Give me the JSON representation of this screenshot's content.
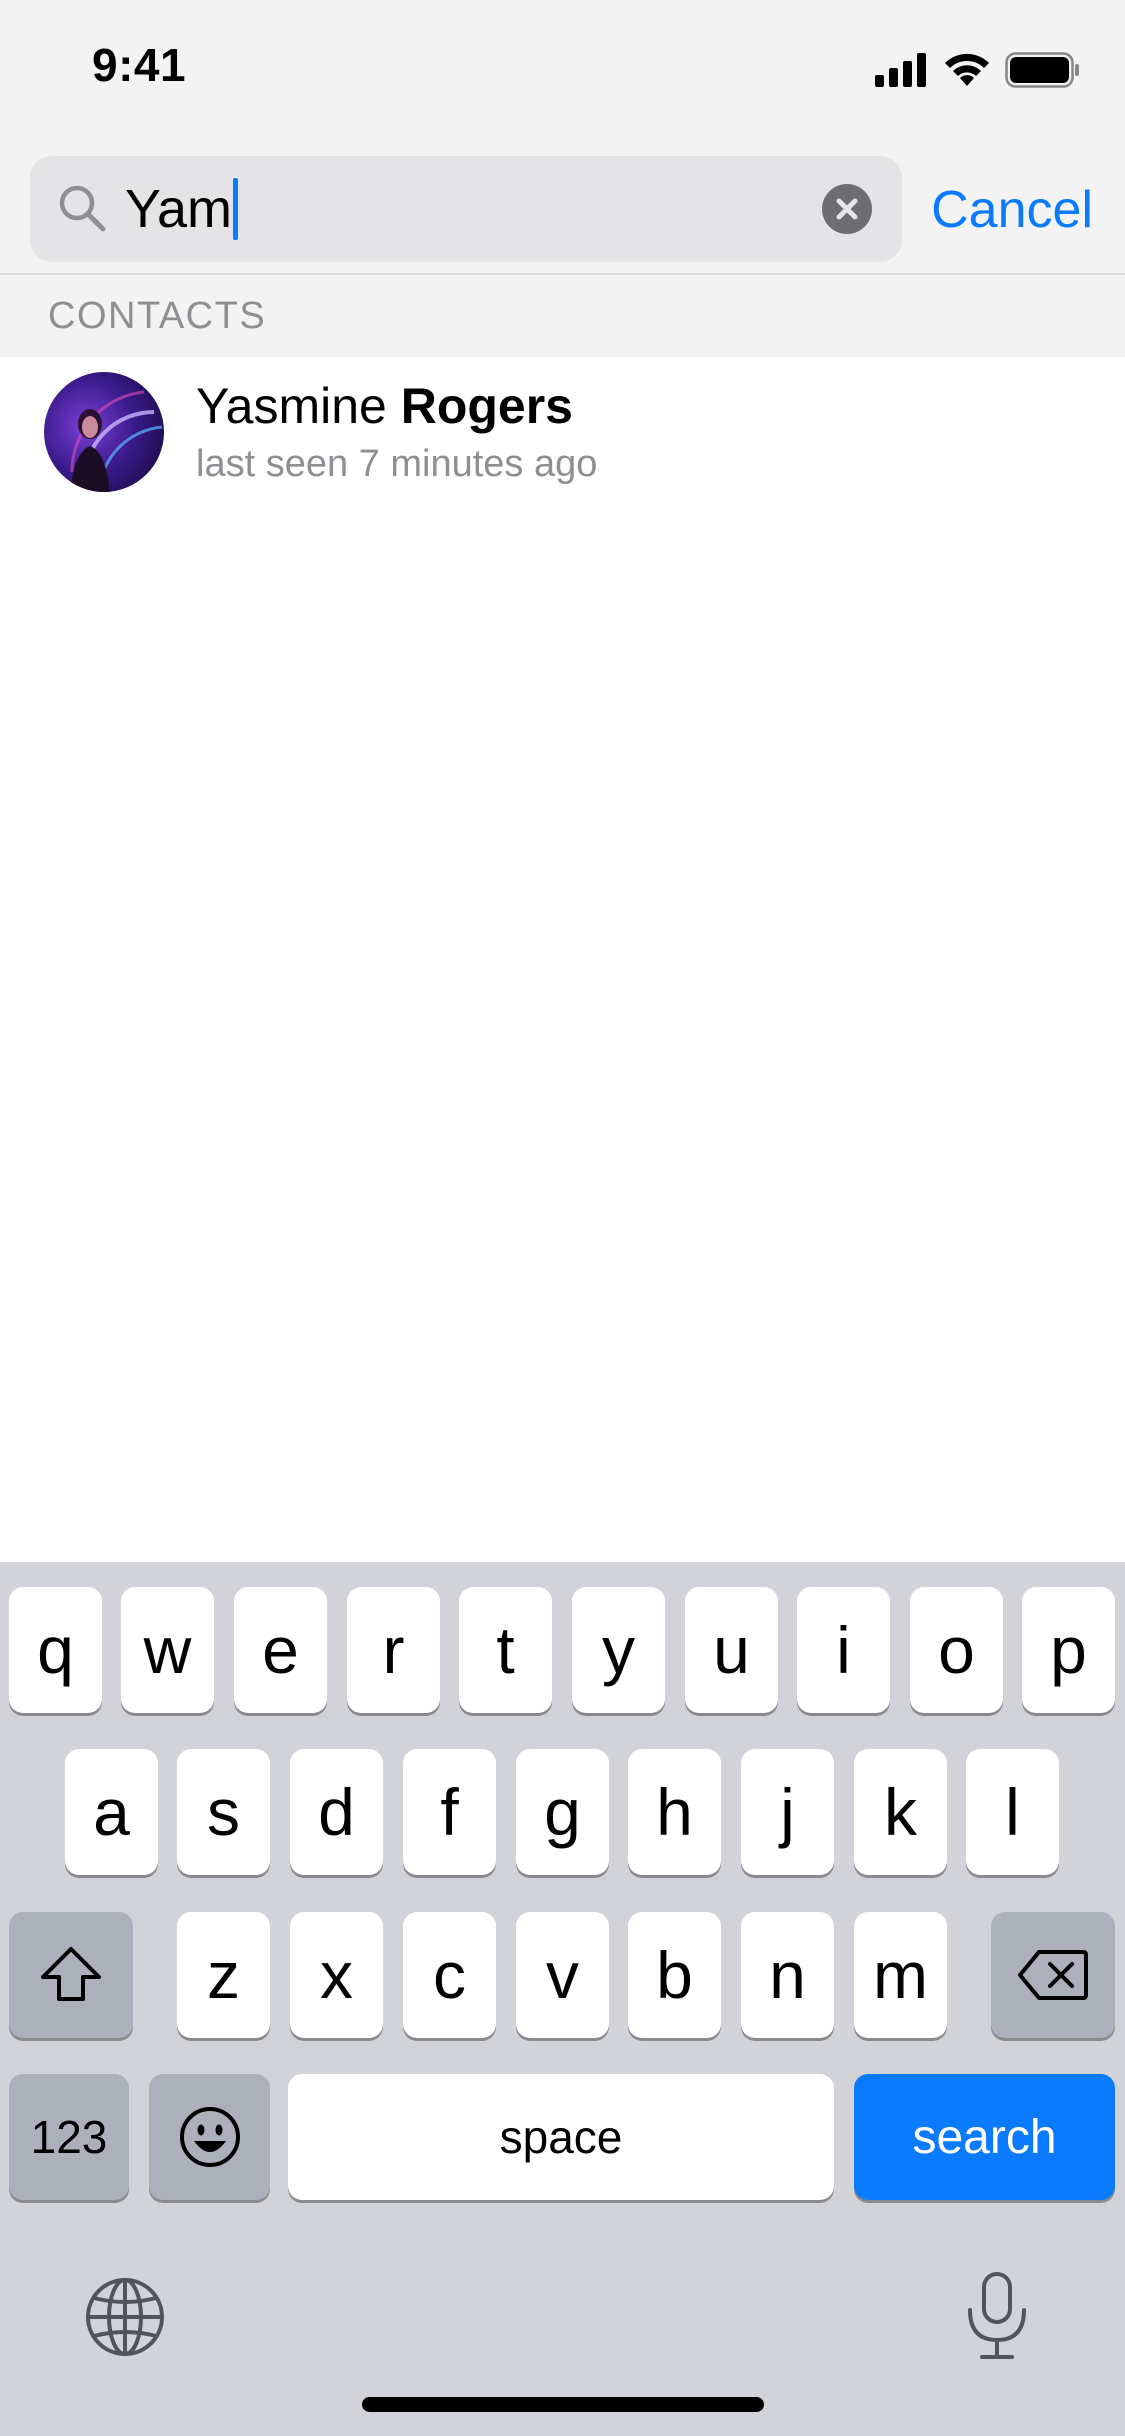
{
  "status_bar": {
    "time": "9:41"
  },
  "search": {
    "value": "Yam",
    "cancel_label": "Cancel"
  },
  "section": {
    "header": "CONTACTS"
  },
  "contact": {
    "name_regular": "Yasmine ",
    "name_bold": "Rogers",
    "status": "last seen 7 minutes ago"
  },
  "keyboard": {
    "row1": [
      "q",
      "w",
      "e",
      "r",
      "t",
      "y",
      "u",
      "i",
      "o",
      "p"
    ],
    "row2": [
      "a",
      "s",
      "d",
      "f",
      "g",
      "h",
      "j",
      "k",
      "l"
    ],
    "row3": [
      "z",
      "x",
      "c",
      "v",
      "b",
      "n",
      "m"
    ],
    "numbers_label": "123",
    "space_label": "space",
    "return_label": "search"
  },
  "colors": {
    "accent": "#0a7aff",
    "keyboard_bg": "#d1d3d9",
    "secondary_text": "#8e8e93"
  }
}
